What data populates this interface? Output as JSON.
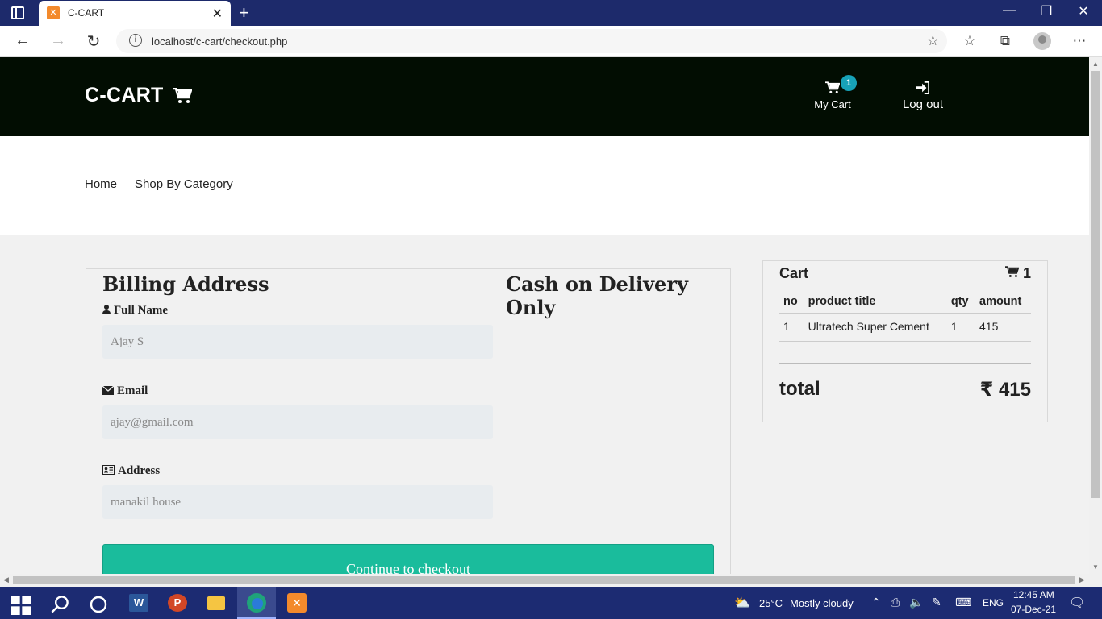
{
  "browser": {
    "tab_title": "C-CART",
    "url": "localhost/c-cart/checkout.php"
  },
  "header": {
    "brand": "C-CART",
    "cart_badge": "1",
    "my_cart_label": "My Cart",
    "logout_label": "Log out"
  },
  "subnav": {
    "home": "Home",
    "shop_by_category": "Shop By Category"
  },
  "billing": {
    "title": "Billing Address",
    "payment_note": "Cash on Delivery Only",
    "full_name_label": "Full Name",
    "full_name_placeholder": "Ajay S",
    "email_label": "Email",
    "email_placeholder": "ajay@gmail.com",
    "address_label": "Address",
    "address_placeholder": "manakil house",
    "submit_label": "Continue to checkout"
  },
  "cart": {
    "title": "Cart",
    "count": "1",
    "columns": [
      "no",
      "product title",
      "qty",
      "amount"
    ],
    "rows": [
      [
        "1",
        "Ultratech Super Cement",
        "1",
        "415"
      ]
    ],
    "total_label": "total",
    "total_value": "₹ 415"
  },
  "taskbar": {
    "weather_temp": "25°C",
    "weather_desc": "Mostly cloudy",
    "lang": "ENG",
    "time": "12:45 AM",
    "date": "07-Dec-21"
  },
  "colors": {
    "header_bg": "#020d02",
    "accent": "#1abc9c",
    "badge": "#17a2b8",
    "taskbar": "#1c2b72"
  }
}
